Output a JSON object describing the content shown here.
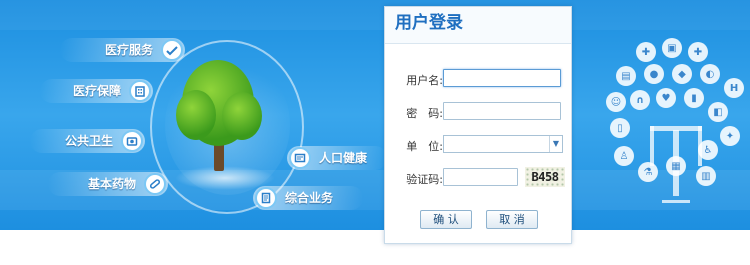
{
  "services_left": [
    {
      "label": "医疗服务",
      "icon": "medical-service-icon"
    },
    {
      "label": "医疗保障",
      "icon": "medical-insurance-icon"
    },
    {
      "label": "公共卫生",
      "icon": "public-health-icon"
    },
    {
      "label": "基本药物",
      "icon": "essential-medicine-icon"
    }
  ],
  "services_right": [
    {
      "label": "人口健康",
      "icon": "population-health-icon"
    },
    {
      "label": "综合业务",
      "icon": "comprehensive-business-icon"
    }
  ],
  "login": {
    "title": "用户登录",
    "username_label": "用户名:",
    "password_label": "密　码:",
    "unit_label": "单　位:",
    "captcha_label": "验证码:",
    "captcha_text": "B458",
    "confirm_label": "确 认",
    "cancel_label": "取 消",
    "username_value": "",
    "password_value": "",
    "unit_value": "",
    "captcha_value": ""
  },
  "colors": {
    "banner_blue": "#2a9be6",
    "title_blue": "#1f6fc0"
  },
  "icon_tree": [
    "syringe-icon",
    "medical-kit-icon",
    "first-aid-icon",
    "bus-icon",
    "blood-drop-icon",
    "scale-icon",
    "pills-icon",
    "baby-icon",
    "stethoscope-icon",
    "hospital-icon",
    "medicine-bottle-icon",
    "heartbeat-icon",
    "test-tube-icon",
    "cup-icon",
    "doctor-icon",
    "capsule-icon",
    "wheelchair-icon",
    "tooth-icon",
    "flask-icon",
    "clipboard-icon"
  ]
}
